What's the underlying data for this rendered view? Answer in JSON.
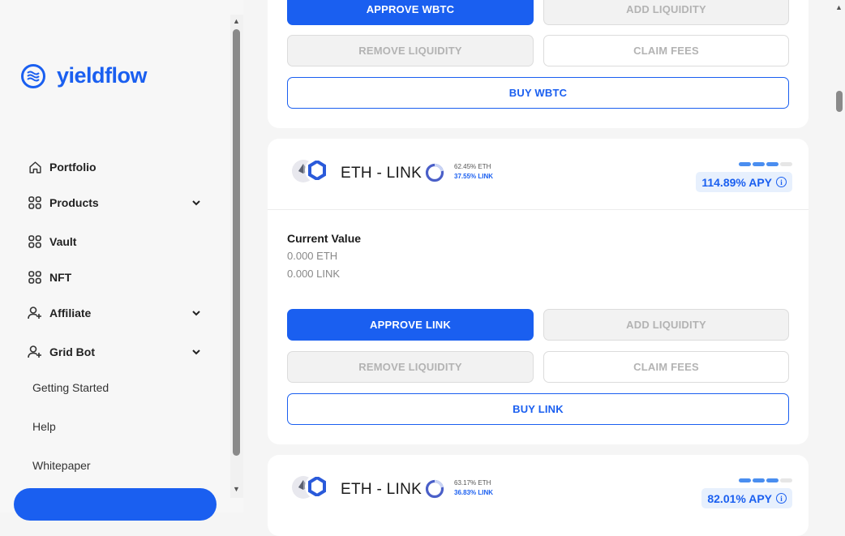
{
  "brand": {
    "name": "yieldflow",
    "color": "#1a5ff0"
  },
  "sidebar": {
    "items": [
      {
        "label": "Portfolio",
        "icon": "home-icon",
        "expandable": false
      },
      {
        "label": "Products",
        "icon": "grid-icon",
        "expandable": true
      },
      {
        "label": "Vault",
        "icon": "grid-icon",
        "expandable": false
      },
      {
        "label": "NFT",
        "icon": "grid-icon",
        "expandable": false
      },
      {
        "label": "Affiliate",
        "icon": "user-plus-icon",
        "expandable": true
      },
      {
        "label": "Grid Bot",
        "icon": "user-plus-icon",
        "expandable": true
      }
    ],
    "links": [
      "Getting Started",
      "Help",
      "Whitepaper"
    ]
  },
  "top_card": {
    "approve_label": "APPROVE WBTC",
    "add_label": "ADD LIQUIDITY",
    "remove_label": "REMOVE LIQUIDITY",
    "claim_label": "CLAIM FEES",
    "buy_label": "BUY WBTC"
  },
  "pool1": {
    "pair": "ETH - LINK",
    "ratio_a": "62.45% ETH",
    "ratio_b": "37.55% LINK",
    "apy": "114.89% APY",
    "risk_level": 3,
    "risk_max": 4,
    "current_value_title": "Current Value",
    "value_a": "0.000 ETH",
    "value_b": "0.000 LINK",
    "approve_label": "APPROVE LINK",
    "add_label": "ADD LIQUIDITY",
    "remove_label": "REMOVE LIQUIDITY",
    "claim_label": "CLAIM FEES",
    "buy_label": "BUY LINK"
  },
  "pool2": {
    "pair": "ETH - LINK",
    "ratio_a": "63.17% ETH",
    "ratio_b": "36.83% LINK",
    "apy": "82.01% APY",
    "risk_level": 3,
    "risk_max": 4
  },
  "colors": {
    "accent": "#1a5ff0",
    "apy_bg": "#e7f0fd"
  }
}
